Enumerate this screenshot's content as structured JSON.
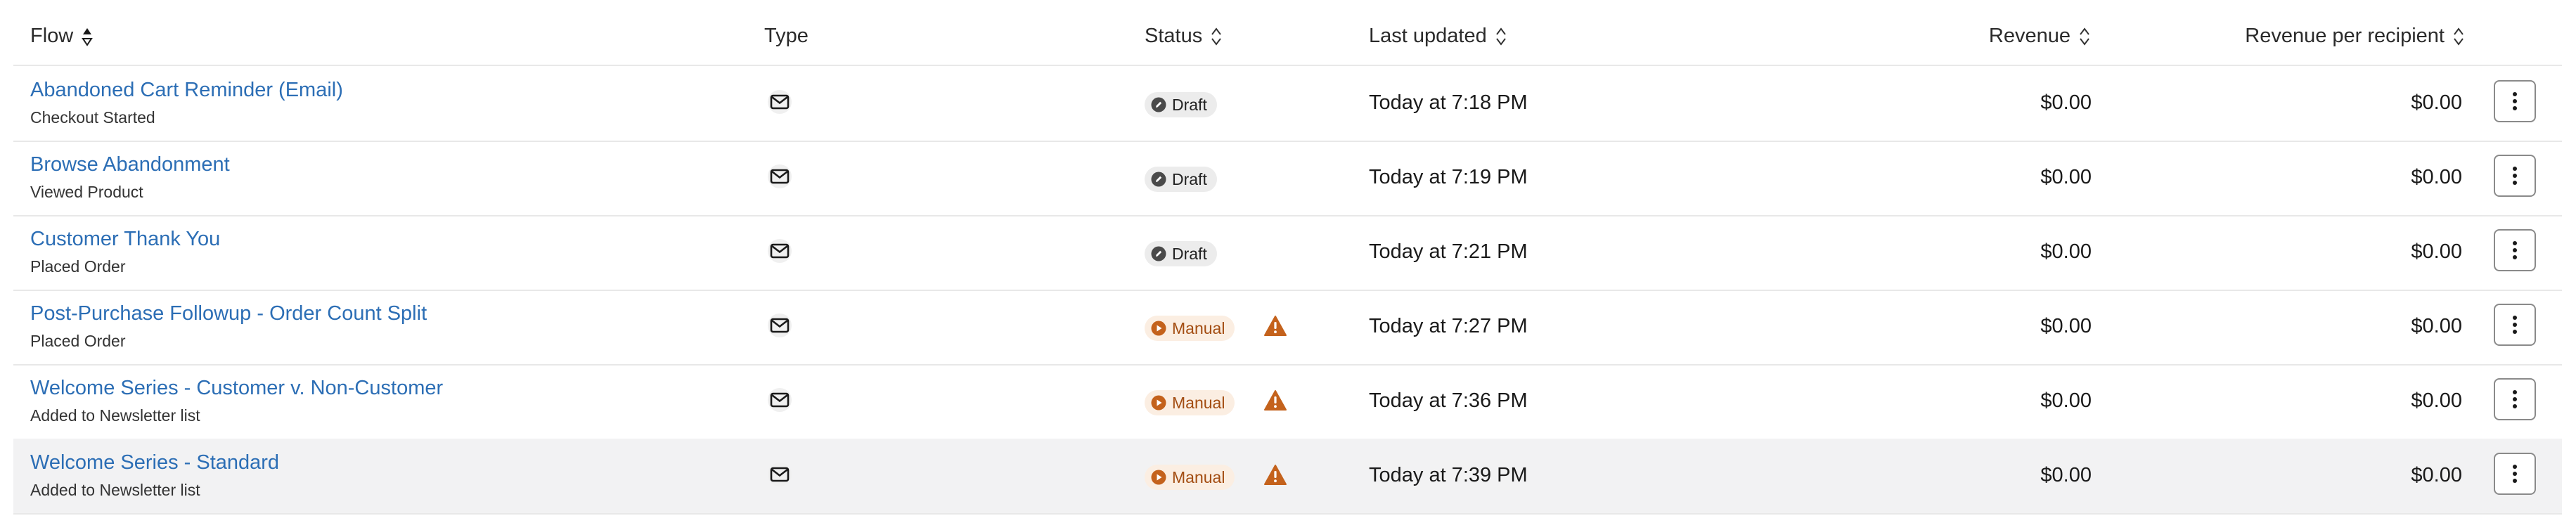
{
  "columns": {
    "flow": "Flow",
    "type": "Type",
    "status": "Status",
    "last_updated": "Last updated",
    "revenue": "Revenue",
    "revenue_per_recipient": "Revenue per recipient"
  },
  "icons": {
    "type": "envelope-icon",
    "sort": "sort-icon",
    "draft": "pencil-icon",
    "manual": "play-icon",
    "warning": "warning-icon",
    "more": "more-vertical-icon"
  },
  "colors": {
    "link": "#2c6eb5",
    "draft_badge_bg": "#ececec",
    "manual_badge_bg": "#fbeee2",
    "manual_badge_text": "#a34d12",
    "warning": "#c4621c",
    "highlight_row": "#f2f2f3"
  },
  "rows": [
    {
      "name": "Abandoned Cart Reminder (Email)",
      "trigger": "Checkout Started",
      "status": "Draft",
      "warning": false,
      "updated": "Today at 7:18 PM",
      "revenue": "$0.00",
      "revenue_per_recipient": "$0.00"
    },
    {
      "name": "Browse Abandonment",
      "trigger": "Viewed Product",
      "status": "Draft",
      "warning": false,
      "updated": "Today at 7:19 PM",
      "revenue": "$0.00",
      "revenue_per_recipient": "$0.00"
    },
    {
      "name": "Customer Thank You",
      "trigger": "Placed Order",
      "status": "Draft",
      "warning": false,
      "updated": "Today at 7:21 PM",
      "revenue": "$0.00",
      "revenue_per_recipient": "$0.00"
    },
    {
      "name": "Post-Purchase Followup - Order Count Split",
      "trigger": "Placed Order",
      "status": "Manual",
      "warning": true,
      "updated": "Today at 7:27 PM",
      "revenue": "$0.00",
      "revenue_per_recipient": "$0.00"
    },
    {
      "name": "Welcome Series - Customer v. Non-Customer",
      "trigger": "Added to Newsletter list",
      "status": "Manual",
      "warning": true,
      "updated": "Today at 7:36 PM",
      "revenue": "$0.00",
      "revenue_per_recipient": "$0.00"
    },
    {
      "name": "Welcome Series - Standard",
      "trigger": "Added to Newsletter list",
      "status": "Manual",
      "warning": true,
      "updated": "Today at 7:39 PM",
      "revenue": "$0.00",
      "revenue_per_recipient": "$0.00",
      "highlighted": true
    }
  ]
}
